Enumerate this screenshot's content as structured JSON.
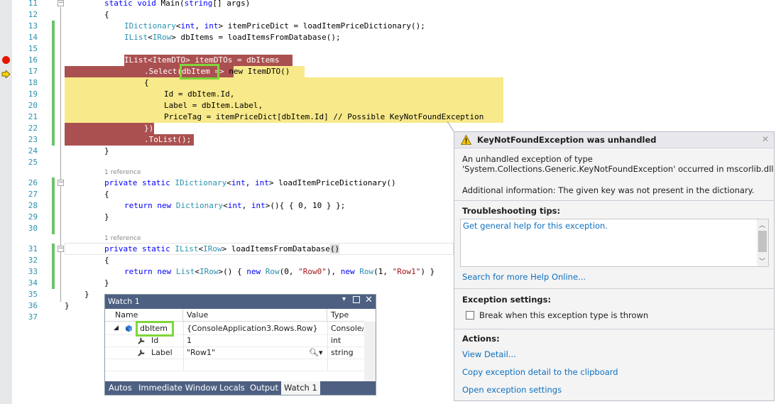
{
  "editor": {
    "lines": [
      {
        "n": "11"
      },
      {
        "n": "12"
      },
      {
        "n": "13"
      },
      {
        "n": "14"
      },
      {
        "n": "15"
      },
      {
        "n": "16"
      },
      {
        "n": "17"
      },
      {
        "n": "18"
      },
      {
        "n": "19"
      },
      {
        "n": "20"
      },
      {
        "n": "21"
      },
      {
        "n": "22"
      },
      {
        "n": "23"
      },
      {
        "n": "24"
      },
      {
        "n": "25"
      },
      {
        "n": "26"
      },
      {
        "n": "27"
      },
      {
        "n": "28"
      },
      {
        "n": "29"
      },
      {
        "n": "30"
      },
      {
        "n": "31"
      },
      {
        "n": "32"
      },
      {
        "n": "33"
      },
      {
        "n": "34"
      },
      {
        "n": "35"
      },
      {
        "n": "36"
      },
      {
        "n": "37"
      }
    ],
    "code": {
      "l11": {
        "kw1": "static",
        "kw2": "void",
        "rest1": " Main(",
        "kw3": "string",
        "rest2": "[] args)"
      },
      "l12": "{",
      "l13": {
        "t1": "IDictionary",
        "p1": "<",
        "k1": "int",
        "p2": ", ",
        "k2": "int",
        "p3": "> itemPriceDict = loadItemPriceDictionary();"
      },
      "l14": {
        "t1": "IList",
        "p1": "<",
        "t2": "IRow",
        "p2": "> dbItems = loadItemsFromDatabase();"
      },
      "l16": "IList<ItemDTO> itemDTOs = dbItems",
      "l17a": ".Select(",
      "l17b": "dbItem",
      "l17c": " => ",
      "l17d": "new ItemDTO()",
      "l18": "{",
      "l19": "Id = dbItem.Id,",
      "l20": "Label = dbItem.Label,",
      "l21": "PriceTag = itemPriceDict[dbItem.Id] // Possible KeyNotFoundException",
      "l22": "})",
      "l23": ".ToList();",
      "l24": "}",
      "l26": {
        "kw1": "private",
        "kw2": "static",
        "t1": "IDictionary",
        "p1": "<",
        "k1": "int",
        "p2": ", ",
        "k2": "int",
        "p3": "> loadItemPriceDictionary()"
      },
      "l27": "{",
      "l28": {
        "kw1": "return",
        "kw2": "new",
        "t1": "Dictionary",
        "p1": "<",
        "k1": "int",
        "p2": ", ",
        "k2": "int",
        "p3": ">(){ { 0, 10 } };"
      },
      "l29": "}",
      "l31": {
        "kw1": "private",
        "kw2": "static",
        "t1": "IList",
        "p1": "<",
        "t2": "IRow",
        "p2": "> loadItemsFromDatabase",
        "p3": "()"
      },
      "l32": "{",
      "l33": {
        "kw1": "return",
        "kw2": "new",
        "t1": "List",
        "p1": "<",
        "t2": "IRow",
        "p2": ">() { ",
        "kw3": "new",
        "t3": "Row",
        "p3": "(0, ",
        "s1": "\"Row0\"",
        "p4": "), ",
        "kw4": "new",
        "t4": "Row",
        "p5": "(1, ",
        "s2": "\"Row1\"",
        "p6": ") }"
      },
      "l34": "}",
      "l35": "}",
      "l36": "}"
    },
    "ref1": "1 reference",
    "ref2": "1 reference"
  },
  "watch": {
    "title": "Watch 1",
    "columns": [
      "Name",
      "Value",
      "Type"
    ],
    "rows": [
      {
        "name": "dbItem",
        "value": "{ConsoleApplication3.Rows.Row}",
        "type": "Console/"
      },
      {
        "name": "Id",
        "value": "1",
        "type": "int"
      },
      {
        "name": "Label",
        "value": "\"Row1\"",
        "type": "string"
      }
    ],
    "tabs": [
      "Autos",
      "Immediate Window",
      "Locals",
      "Output",
      "Watch 1"
    ]
  },
  "exception": {
    "title": "KeyNotFoundException was unhandled",
    "message1": "An unhandled exception of type",
    "message2": "'System.Collections.Generic.KeyNotFoundException' occurred in mscorlib.dll",
    "additional": "Additional information: The given key was not present in the dictionary.",
    "troubleshooting_header": "Troubleshooting tips:",
    "tip_link": "Get general help for this exception.",
    "search_link": "Search for more Help Online...",
    "settings_header": "Exception settings:",
    "checkbox_label": "Break when this exception type is thrown",
    "actions_header": "Actions:",
    "actions": [
      "View Detail...",
      "Copy exception detail to the clipboard",
      "Open exception settings"
    ]
  },
  "colors": {
    "breakpoint": "#e51400",
    "highlight_red": "#ab5050",
    "highlight_yellow": "#f8e98a",
    "callout_green": "#7fd63a",
    "link_blue": "#0e70c0"
  }
}
